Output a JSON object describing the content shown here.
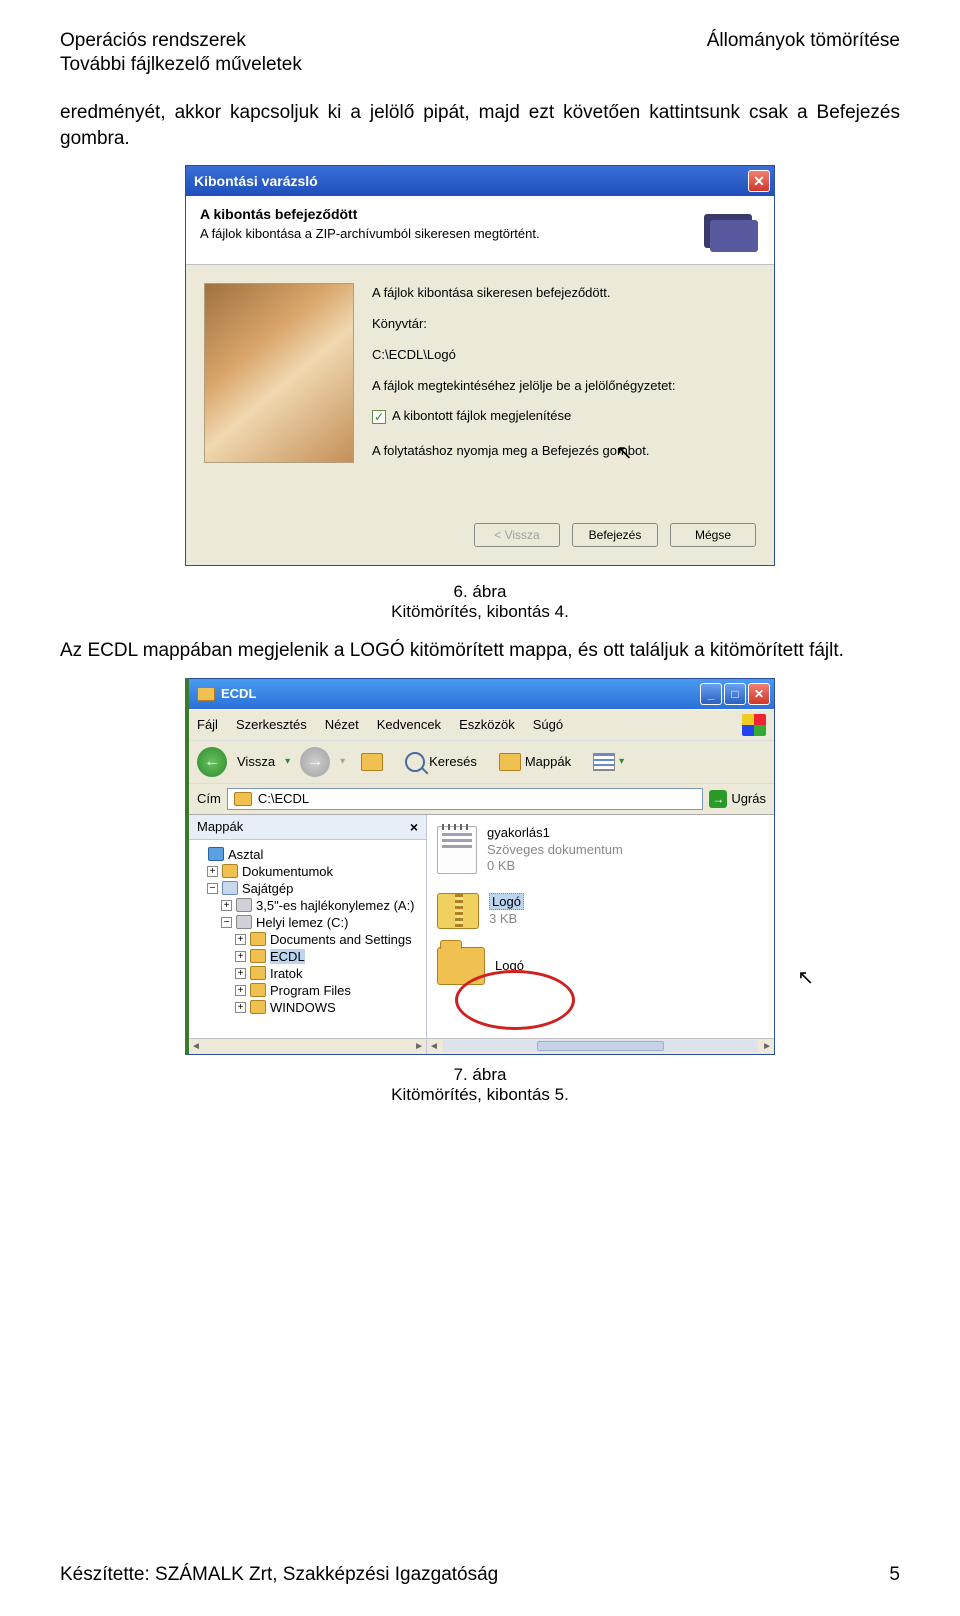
{
  "header": {
    "left": "Operációs rendszerek",
    "right": "Állományok tömörítése",
    "sub": "További fájlkezelő műveletek"
  },
  "para1": "eredményét, akkor kapcsoljuk ki a jelölő pipát, majd ezt követően kattintsunk csak a Befejezés gombra.",
  "wizard": {
    "title": "Kibontási varázsló",
    "head_title": "A kibontás befejeződött",
    "head_sub": "A fájlok kibontása a ZIP-archívumból sikeresen megtörtént.",
    "line1": "A fájlok kibontása sikeresen befejeződött.",
    "line2": "Könyvtár:",
    "path": "C:\\ECDL\\Logó",
    "line3": "A fájlok megtekintéséhez jelölje be a jelölőnégyzetet:",
    "chk_label": "A kibontott fájlok megjelenítése",
    "line4": "A folytatáshoz nyomja meg a Befejezés gombot.",
    "btn_back": "< Vissza",
    "btn_finish": "Befejezés",
    "btn_cancel": "Mégse"
  },
  "caption1a": "6. ábra",
  "caption1b": "Kitömörítés, kibontás 4.",
  "para2": "Az ECDL mappában megjelenik a LOGÓ kitömörített mappa, és ott találjuk a kitömörített fájlt.",
  "explorer": {
    "title": "ECDL",
    "menu": [
      "Fájl",
      "Szerkesztés",
      "Nézet",
      "Kedvencek",
      "Eszközök",
      "Súgó"
    ],
    "back": "Vissza",
    "search": "Keresés",
    "folders": "Mappák",
    "addr_label": "Cím",
    "addr_value": "C:\\ECDL",
    "go": "Ugrás",
    "sidebar_title": "Mappák",
    "tree": {
      "desktop": "Asztal",
      "docs": "Dokumentumok",
      "mycomp": "Sajátgép",
      "floppy": "3,5\"-es hajlékonylemez (A:)",
      "localdisk": "Helyi lemez (C:)",
      "das": "Documents and Settings",
      "ecdl": "ECDL",
      "iratok": "Iratok",
      "pf": "Program Files",
      "win": "WINDOWS"
    },
    "file1": {
      "name": "gyakorlás1",
      "type": "Szöveges dokumentum",
      "size": "0 KB"
    },
    "file2": {
      "name": "Logó",
      "size": "3 KB"
    },
    "file3": {
      "name": "Logó"
    }
  },
  "caption2a": "7. ábra",
  "caption2b": "Kitömörítés, kibontás 5.",
  "footer": {
    "left": "Készítette: SZÁMALK Zrt, Szakképzési Igazgatóság",
    "right": "5"
  }
}
